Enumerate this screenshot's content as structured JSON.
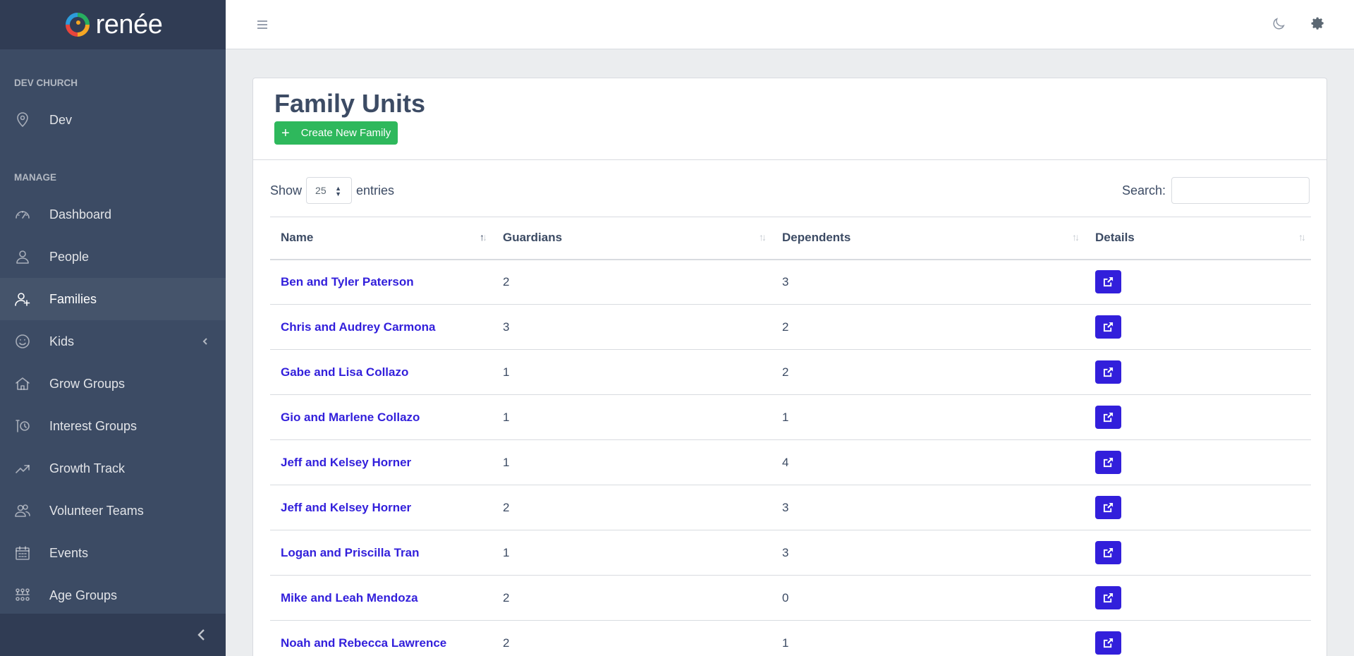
{
  "brand": {
    "name": "renée"
  },
  "sidebar": {
    "sections": [
      {
        "title": "DEV CHURCH",
        "items": [
          {
            "label": "Dev",
            "icon": "location-pin-icon"
          }
        ]
      },
      {
        "title": "MANAGE",
        "items": [
          {
            "label": "Dashboard",
            "icon": "speedometer-icon"
          },
          {
            "label": "People",
            "icon": "user-icon"
          },
          {
            "label": "Families",
            "icon": "user-plus-icon",
            "active": true
          },
          {
            "label": "Kids",
            "icon": "smile-icon",
            "has_children": true
          },
          {
            "label": "Grow Groups",
            "icon": "home-icon"
          },
          {
            "label": "Interest Groups",
            "icon": "people-icon"
          },
          {
            "label": "Growth Track",
            "icon": "trending-up-icon"
          },
          {
            "label": "Volunteer Teams",
            "icon": "group-icon"
          },
          {
            "label": "Events",
            "icon": "calendar-icon"
          },
          {
            "label": "Age Groups",
            "icon": "sitemap-icon"
          }
        ]
      }
    ]
  },
  "header": {
    "menu_icon": "hamburger-icon",
    "theme_icon": "moon-icon",
    "settings_icon": "gear-icon"
  },
  "page": {
    "title": "Family Units",
    "create_button": "Create New Family",
    "show_label": "Show",
    "entries_label": "entries",
    "page_length": "25",
    "search_label": "Search:",
    "search_value": ""
  },
  "table": {
    "columns": [
      "Name",
      "Guardians",
      "Dependents",
      "Details"
    ],
    "rows": [
      {
        "name": "Ben and Tyler Paterson",
        "guardians": "2",
        "dependents": "3"
      },
      {
        "name": "Chris and Audrey Carmona",
        "guardians": "3",
        "dependents": "2"
      },
      {
        "name": "Gabe and Lisa Collazo",
        "guardians": "1",
        "dependents": "2"
      },
      {
        "name": "Gio and Marlene Collazo",
        "guardians": "1",
        "dependents": "1"
      },
      {
        "name": "Jeff and Kelsey Horner",
        "guardians": "1",
        "dependents": "4"
      },
      {
        "name": "Jeff and Kelsey Horner",
        "guardians": "2",
        "dependents": "3"
      },
      {
        "name": "Logan and Priscilla Tran",
        "guardians": "1",
        "dependents": "3"
      },
      {
        "name": "Mike and Leah Mendoza",
        "guardians": "2",
        "dependents": "0"
      },
      {
        "name": "Noah and Rebecca Lawrence",
        "guardians": "2",
        "dependents": "1"
      }
    ]
  },
  "colors": {
    "sidebar": "#3c4b64",
    "primary": "#321fdb",
    "success": "#2eb85c"
  }
}
